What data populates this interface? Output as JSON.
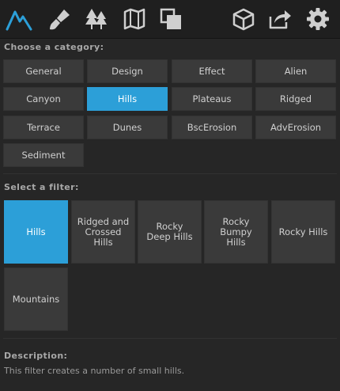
{
  "toolbar": {
    "left_icons": [
      "terrain-icon",
      "brush-icon",
      "trees-icon",
      "map-icon",
      "layers-icon"
    ],
    "right_icons": [
      "cube-icon",
      "export-icon",
      "settings-icon"
    ],
    "accent": "#2c9fd8"
  },
  "category_section": {
    "title": "Choose a category:",
    "items": [
      {
        "label": "General"
      },
      {
        "label": "Design"
      },
      {
        "label": "Effect"
      },
      {
        "label": "Alien"
      },
      {
        "label": "Canyon"
      },
      {
        "label": "Hills",
        "selected": true
      },
      {
        "label": "Plateaus"
      },
      {
        "label": "Ridged"
      },
      {
        "label": "Terrace"
      },
      {
        "label": "Dunes"
      },
      {
        "label": "BscErosion"
      },
      {
        "label": "AdvErosion"
      },
      {
        "label": "Sediment"
      }
    ]
  },
  "filter_section": {
    "title": "Select a filter:",
    "items": [
      {
        "label": "Hills",
        "selected": true
      },
      {
        "label": "Ridged and Crossed Hills"
      },
      {
        "label": "Rocky Deep Hills"
      },
      {
        "label": "Rocky Bumpy Hills"
      },
      {
        "label": "Rocky Hills"
      },
      {
        "label": "Mountains"
      }
    ]
  },
  "description": {
    "title": "Description:",
    "text": "This filter creates a number of small hills."
  }
}
